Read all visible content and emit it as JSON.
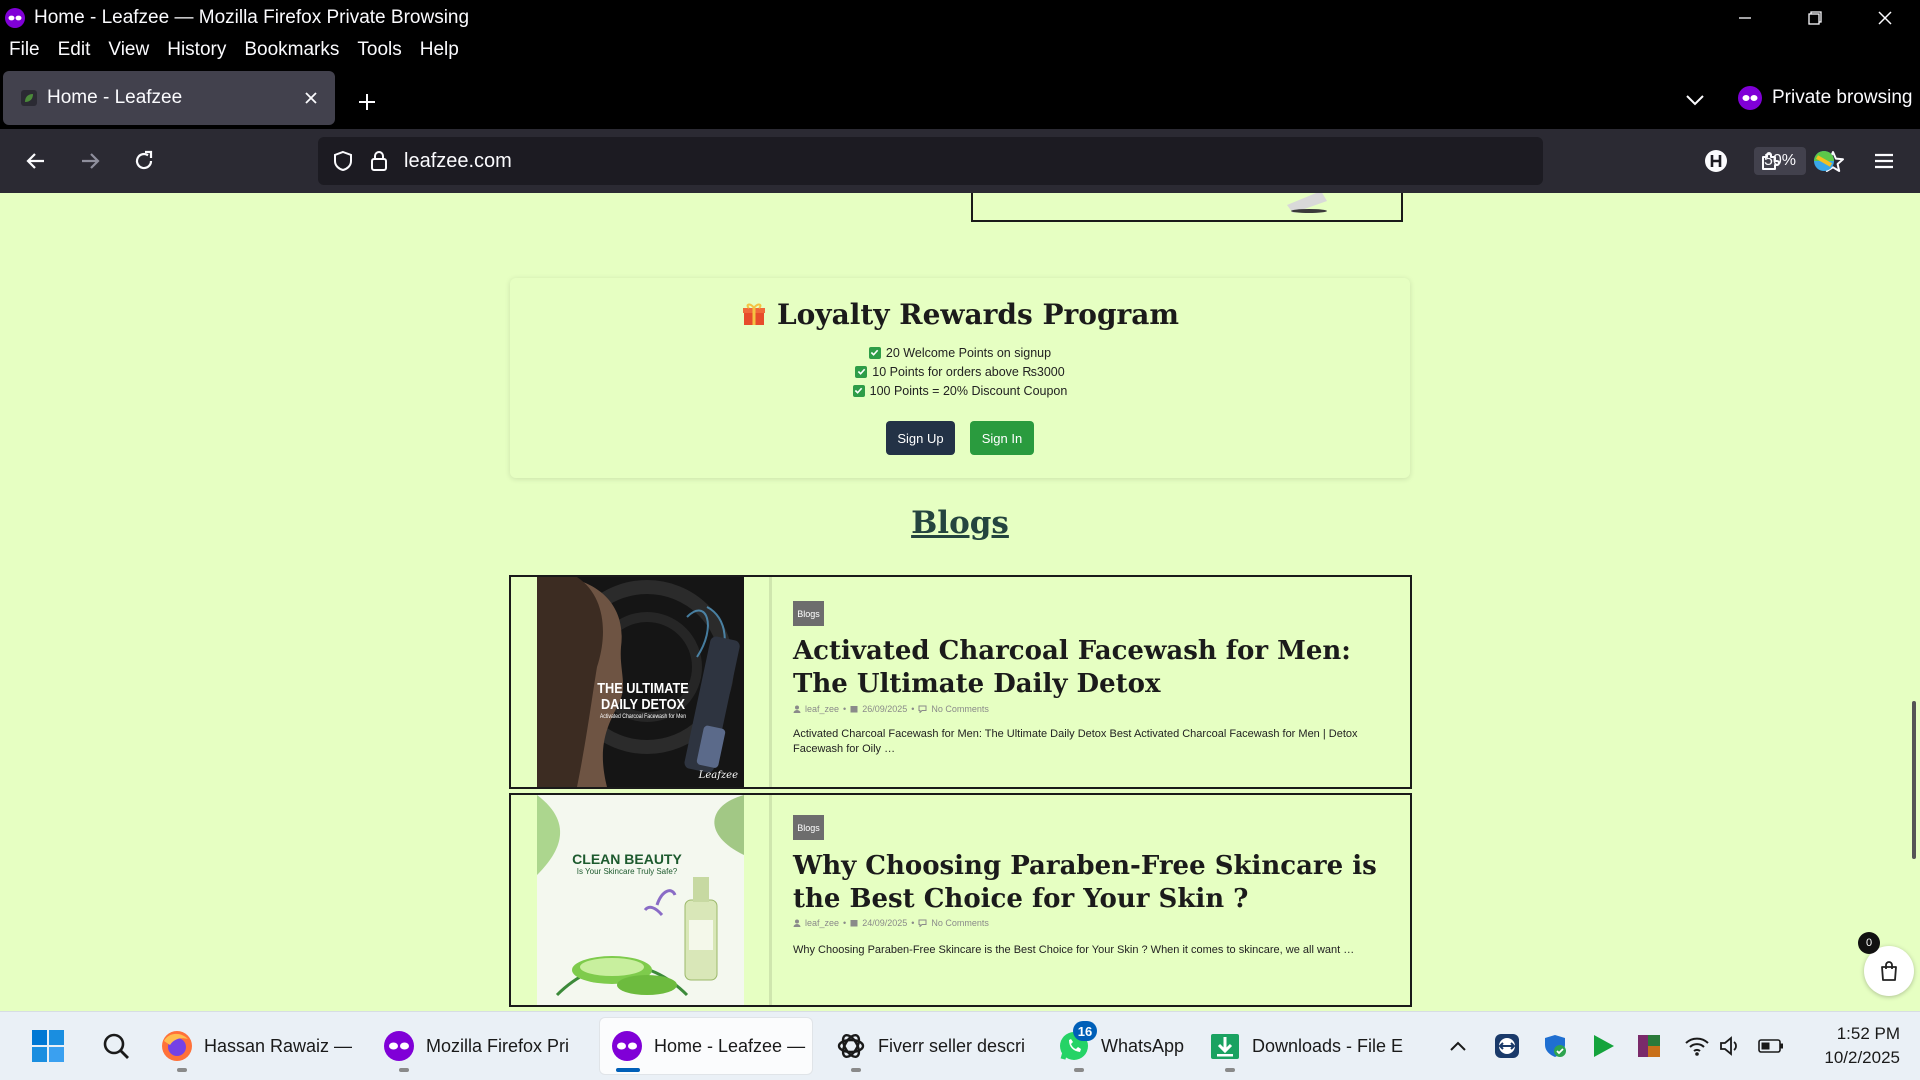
{
  "window": {
    "title": "Home - Leafzee — Mozilla Firefox Private Browsing"
  },
  "menu": [
    "File",
    "Edit",
    "View",
    "History",
    "Bookmarks",
    "Tools",
    "Help"
  ],
  "tab": {
    "title": "Home - Leafzee"
  },
  "private_label": "Private browsing",
  "urlbar": {
    "url": "leafzee.com",
    "zoom": "50%"
  },
  "loyalty": {
    "heading": "Loyalty Rewards Program",
    "perks": [
      "20 Welcome Points on signup",
      "10 Points for orders above ₨3000",
      "100 Points = 20% Discount Coupon"
    ],
    "signup_label": "Sign Up",
    "signin_label": "Sign In"
  },
  "blogs": {
    "title": "Blogs",
    "posts": [
      {
        "badge": "Blogs",
        "title": "Activated Charcoal Facewash for Men: The Ultimate Daily Detox",
        "author": "leaf_zee",
        "date": "26/09/2025",
        "comments": "No Comments",
        "excerpt": "Activated Charcoal Facewash for Men: The Ultimate Daily Detox Best Activated Charcoal Facewash for Men | Detox Facewash for Oily …",
        "image_text_line1": "THE ULTIMATE",
        "image_text_line2": "DAILY DETOX",
        "image_text_line3": "Activated Charcoal Facewash for Men",
        "image_brand": "Leafzee"
      },
      {
        "badge": "Blogs",
        "title": "Why Choosing Paraben-Free Skincare is the Best Choice for Your Skin ?",
        "author": "leaf_zee",
        "date": "24/09/2025",
        "comments": "No Comments",
        "excerpt": "Why Choosing Paraben-Free Skincare is the Best Choice for Your Skin ? When it comes to skincare, we all want …",
        "image_text_line1": "CLEAN BEAUTY",
        "image_text_line2": "Is Your Skincare Truly Safe?"
      }
    ]
  },
  "cart": {
    "count": "0"
  },
  "taskbar": {
    "items": [
      {
        "label": "Hassan Rawaiz —",
        "icon": "firefox-icon"
      },
      {
        "label": "Mozilla Firefox Pri",
        "icon": "firefox-private-icon"
      },
      {
        "label": "Home - Leafzee —",
        "icon": "firefox-private-icon"
      },
      {
        "label": "Fiverr seller descri",
        "icon": "chatgpt-icon"
      },
      {
        "label": "WhatsApp",
        "icon": "whatsapp-icon",
        "badge": "16"
      },
      {
        "label": "Downloads - File E",
        "icon": "file-explorer-icon"
      }
    ],
    "time": "1:52 PM",
    "date": "10/2/2025"
  },
  "colors": {
    "page_bg": "#e6ffc2",
    "signup": "#233246",
    "signin": "#2a9b3e",
    "private_purple": "#8000d7"
  }
}
